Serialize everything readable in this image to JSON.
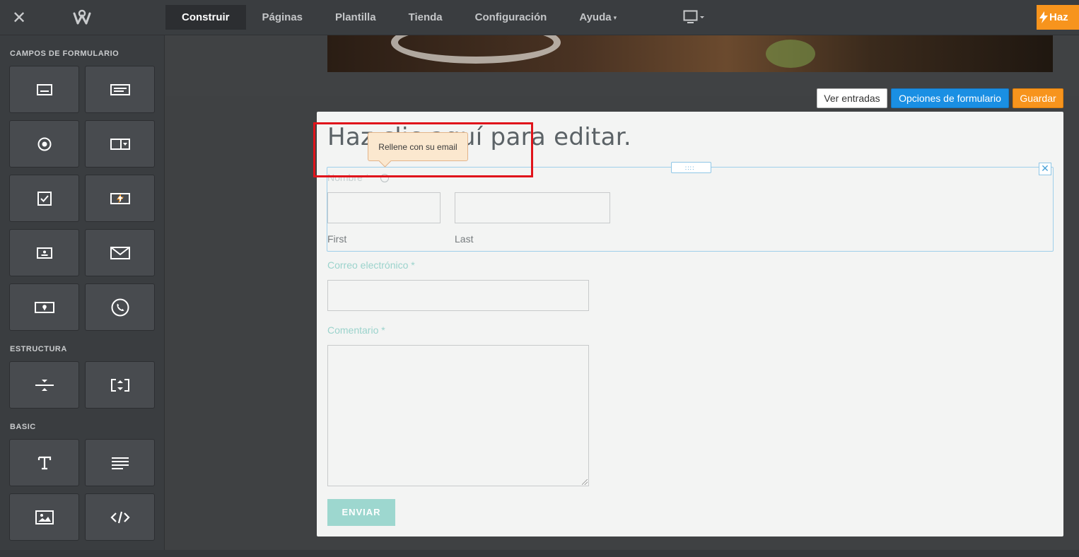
{
  "topbar": {
    "nav": [
      {
        "label": "Construir",
        "active": true
      },
      {
        "label": "Páginas",
        "active": false
      },
      {
        "label": "Plantilla",
        "active": false
      },
      {
        "label": "Tienda",
        "active": false
      },
      {
        "label": "Configuración",
        "active": false
      },
      {
        "label": "Ayuda",
        "active": false,
        "dropdown": true
      }
    ],
    "upgrade_label": "Haz",
    "icons": {
      "close": "close-icon",
      "logo": "weebly-logo",
      "device": "desktop-monitor-icon",
      "upgrade": "lightning-bolt-icon"
    }
  },
  "sidebar": {
    "sections": {
      "form_fields": "CAMPOS DE FORMULARIO",
      "structure": "ESTRUCTURA",
      "basic": "BASIC"
    },
    "form_field_tiles": [
      "single-line-input-icon",
      "paragraph-input-icon",
      "radio-button-icon",
      "dropdown-select-icon",
      "checkbox-icon",
      "file-upload-icon",
      "name-card-icon",
      "email-envelope-icon",
      "address-pin-icon",
      "phone-icon"
    ],
    "structure_tiles": [
      "divider-icon",
      "spacer-icon"
    ],
    "basic_tiles": [
      "title-text-icon",
      "paragraph-text-icon",
      "image-icon",
      "embed-code-icon"
    ]
  },
  "form_toolbar": {
    "view_entries": "Ver entradas",
    "form_options": "Opciones de formulario",
    "save": "Guardar"
  },
  "form": {
    "title": "Haz clic aquí para editar.",
    "name_field": {
      "label": "Nombre *",
      "first": "First",
      "last": "Last"
    },
    "email_field": {
      "label": "Correo electrónico *"
    },
    "comment_field": {
      "label": "Comentario *"
    },
    "submit": "ENVIAR"
  },
  "tooltip": {
    "text": "Rellene con su email"
  },
  "colors": {
    "accent_orange": "#f7941d",
    "accent_blue": "#1a8fe3",
    "highlight_red": "#e0141b",
    "label_teal": "#9bd3cc"
  }
}
